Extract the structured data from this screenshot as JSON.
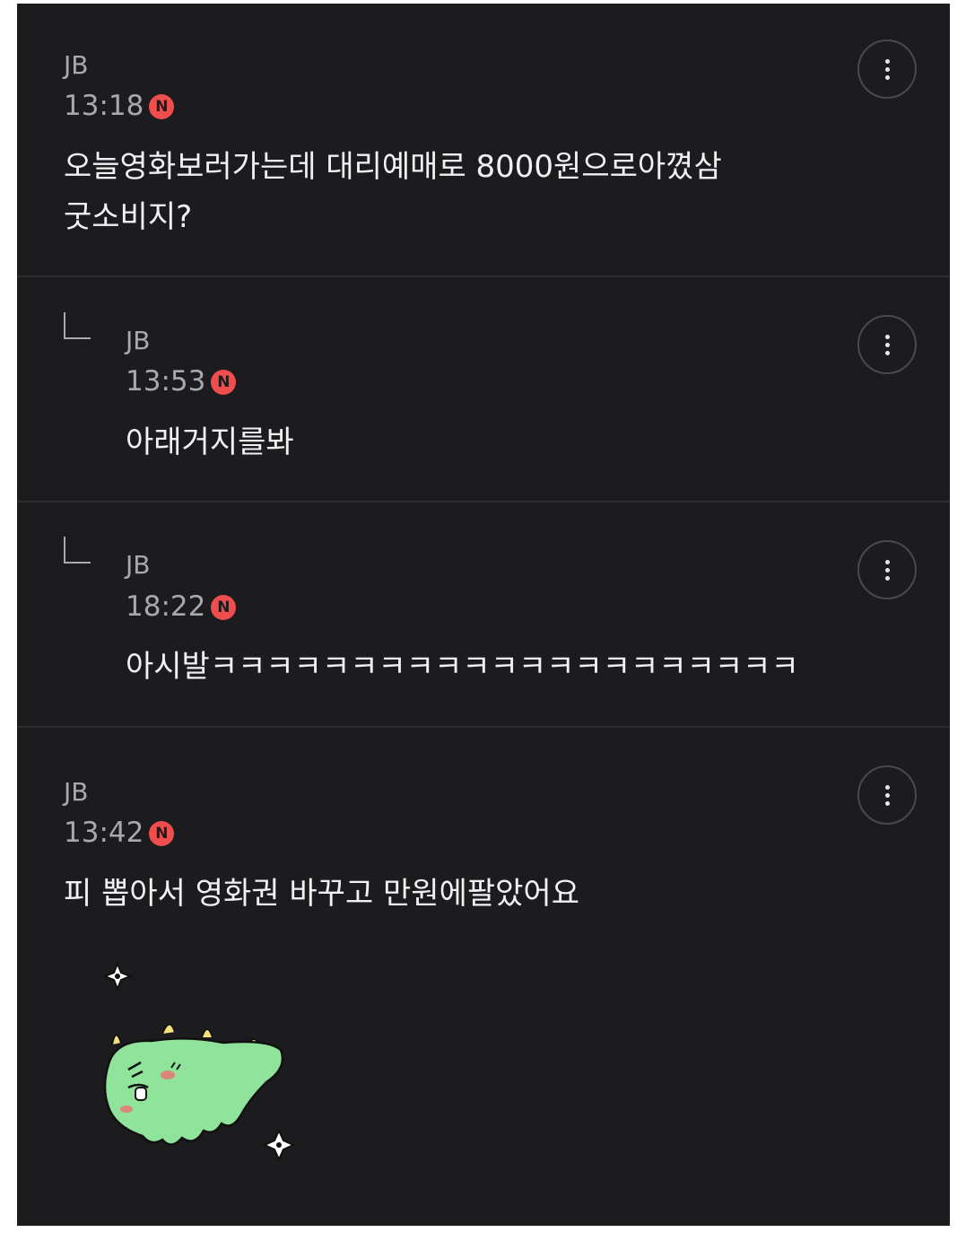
{
  "comments": [
    {
      "author": "JB",
      "time": "13:18",
      "badge": "N",
      "text": "오늘영화보러가는데 대리예매로 8000원으로아꼈삼\n굿소비지?",
      "is_reply": false
    },
    {
      "author": "JB",
      "time": "13:53",
      "badge": "N",
      "text": "아래거지를봐",
      "is_reply": true
    },
    {
      "author": "JB",
      "time": "18:22",
      "badge": "N",
      "text": "아시발ㅋㅋㅋㅋㅋㅋㅋㅋㅋㅋㅋㅋㅋㅋㅋㅋㅋㅋㅋㅋㅋ",
      "is_reply": true
    },
    {
      "author": "JB",
      "time": "13:42",
      "badge": "N",
      "text": "피 뽑아서 영화권 바꾸고 만원에팔았어요",
      "is_reply": false,
      "sticker": "green-creature-sticker"
    }
  ],
  "colors": {
    "background": "#1c1c1e",
    "text": "#f1f1f3",
    "meta": "#a9a9ad",
    "new_badge": "#f04e4e",
    "sticker_body": "#8fe39b"
  },
  "icons": {
    "more": "vertical-ellipsis-icon",
    "reply": "reply-corner-icon",
    "new": "new-badge-icon"
  }
}
